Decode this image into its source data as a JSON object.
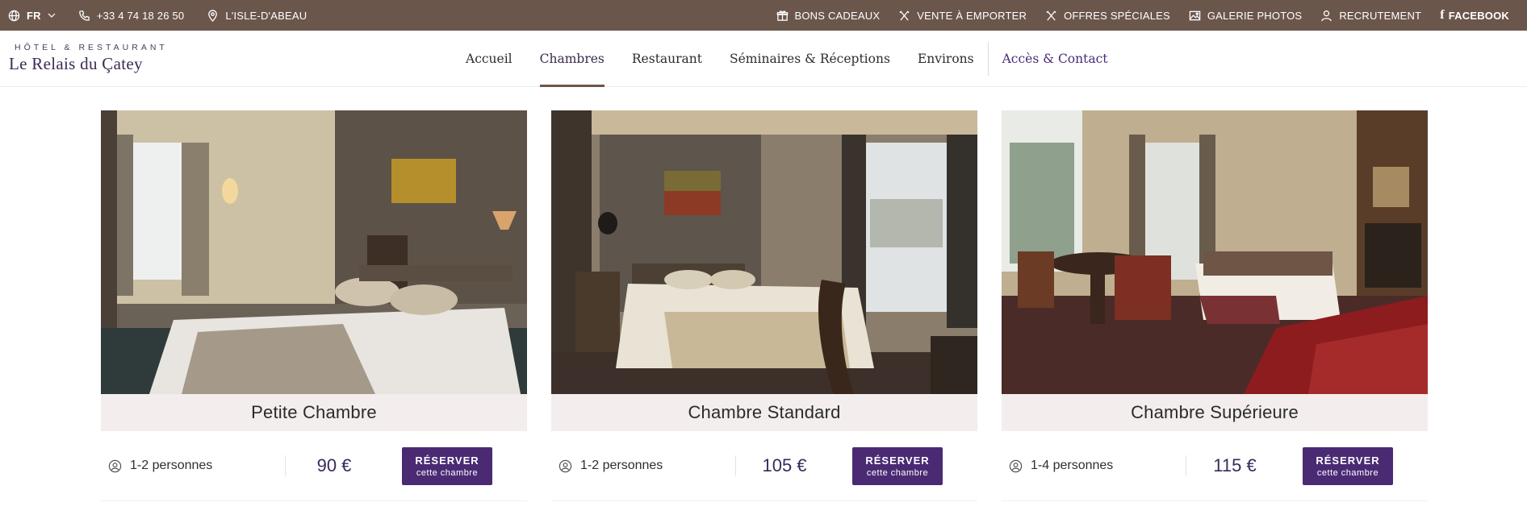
{
  "topbar": {
    "language": "FR",
    "phone": "+33 4 74 18 26 50",
    "location": "L'ISLE-D'ABEAU",
    "links": [
      {
        "label": "BONS CADEAUX",
        "icon": "gift-icon"
      },
      {
        "label": "VENTE À EMPORTER",
        "icon": "cutlery-icon"
      },
      {
        "label": "OFFRES SPÉCIALES",
        "icon": "cutlery-icon"
      },
      {
        "label": "GALERIE PHOTOS",
        "icon": "image-icon"
      },
      {
        "label": "RECRUTEMENT",
        "icon": "user-icon"
      },
      {
        "label": "FACEBOOK",
        "icon": "facebook-icon"
      }
    ]
  },
  "logo": {
    "small": "Hôtel & Restaurant",
    "big": "Le Relais du Çatey"
  },
  "nav": {
    "items": [
      {
        "label": "Accueil"
      },
      {
        "label": "Chambres",
        "active": true
      },
      {
        "label": "Restaurant"
      },
      {
        "label": "Séminaires & Réceptions"
      },
      {
        "label": "Environs"
      }
    ],
    "contact": "Accès & Contact"
  },
  "rooms": [
    {
      "title": "Petite Chambre",
      "persons": "1-2 personnes",
      "price": "90 €",
      "button_main": "RÉSERVER",
      "button_sub": "cette chambre"
    },
    {
      "title": "Chambre Standard",
      "persons": "1-2 personnes",
      "price": "105 €",
      "button_main": "RÉSERVER",
      "button_sub": "cette chambre"
    },
    {
      "title": "Chambre Supérieure",
      "persons": "1-4 personnes",
      "price": "115 €",
      "button_main": "RÉSERVER",
      "button_sub": "cette chambre"
    }
  ],
  "colors": {
    "topbar": "#6b564c",
    "brand_purple": "#4b2a74",
    "card_title_bg": "#f3eded"
  }
}
